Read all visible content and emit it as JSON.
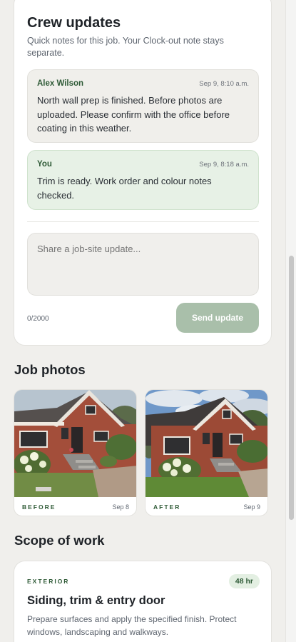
{
  "crew": {
    "title": "Crew updates",
    "subtitle": "Quick notes for this job. Your Clock-out note stays separate.",
    "messages": [
      {
        "author": "Alex Wilson",
        "time": "Sep 9, 8:10 a.m.",
        "text": "North wall prep is finished. Before photos are uploaded. Please confirm with the office before coating in this weather.",
        "mine": false
      },
      {
        "author": "You",
        "time": "Sep 9, 8:18 a.m.",
        "text": "Trim is ready. Work order and colour notes checked.",
        "mine": true
      }
    ],
    "input_placeholder": "Share a job-site update...",
    "input_value": "",
    "char_count": "0/2000",
    "send_label": "Send update"
  },
  "photos": {
    "title": "Job photos",
    "items": [
      {
        "label": "BEFORE",
        "date": "Sep 8"
      },
      {
        "label": "AFTER",
        "date": "Sep 9"
      }
    ]
  },
  "scope": {
    "title": "Scope of work",
    "category": "EXTERIOR",
    "hours": "48 hr",
    "name": "Siding, trim & entry door",
    "description": "Prepare surfaces and apply the specified finish. Protect windows, landscaping and walkways."
  },
  "colors": {
    "accent": "#2e5a36",
    "send_button_disabled": "#a9bfaa",
    "own_message_bg": "#e7f1e6",
    "other_message_bg": "#f0efeb",
    "page_bg": "#f0efec"
  }
}
